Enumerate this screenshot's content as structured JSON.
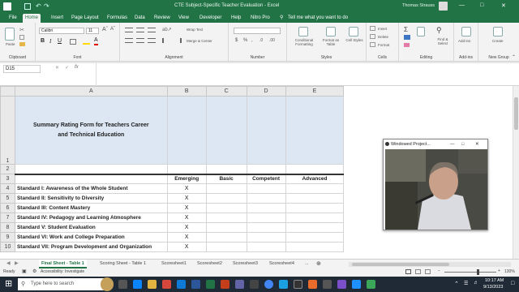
{
  "window": {
    "title": "CTE Subject-Specific Teacher Evaluation  -  Excel",
    "user": "Thomas Strauss",
    "minimize": "—",
    "maximize": "□",
    "close": "✕"
  },
  "ribbon_tabs": [
    "File",
    "Home",
    "Insert",
    "Page Layout",
    "Formulas",
    "Data",
    "Review",
    "View",
    "Developer",
    "Help",
    "Nitro Pro"
  ],
  "ribbon_active_tab": "Home",
  "tell_me": "Tell me what you want to do",
  "ribbon_groups": {
    "clipboard": "Clipboard",
    "font": "Font",
    "alignment": "Alignment",
    "number": "Number",
    "styles": "Styles",
    "cells": "Cells",
    "editing": "Editing",
    "addins": "Add-ins",
    "new_group": "New Group"
  },
  "ribbon_controls": {
    "paste": "Paste",
    "font_name": "Calibri",
    "font_size": "11",
    "bold": "B",
    "italic": "I",
    "underline": "U",
    "wrap_text": "Wrap Text",
    "merge_center": "Merge & Center",
    "number_format": "",
    "conditional": "Conditional Formatting",
    "format_table": "Format as Table",
    "cell_styles": "Cell Styles",
    "insert": "Insert",
    "delete": "Delete",
    "format": "Format",
    "sum": "Σ",
    "find_select": "Find & Select",
    "addins": "Add-ins",
    "create": "Create"
  },
  "formula_bar": {
    "name_box": "D15",
    "cancel": "✕",
    "enter": "✓",
    "fx": "fx",
    "formula": ""
  },
  "sheet": {
    "columns": [
      "A",
      "B",
      "C",
      "D",
      "E"
    ],
    "title": "Summary Rating Form for Teachers Career and Technical Education",
    "headers": [
      "Emerging",
      "Basic",
      "Competent",
      "Advanced"
    ],
    "rows": [
      {
        "num": "4",
        "label": "Standard I: Awareness of the Whole Student",
        "emerging": "X"
      },
      {
        "num": "5",
        "label": "Standard II: Sensitivity to Diversity",
        "emerging": "X"
      },
      {
        "num": "6",
        "label": "Standard III: Content Mastery",
        "emerging": "X"
      },
      {
        "num": "7",
        "label": "Standard IV: Pedagogy and Learning Atmosphere",
        "emerging": "X"
      },
      {
        "num": "8",
        "label": "Standard V:  Student Evaluation",
        "emerging": "X"
      },
      {
        "num": "9",
        "label": "Standard VI: Work and College Preparation",
        "emerging": "X"
      },
      {
        "num": "10",
        "label": "Standard VII: Program Development and Organization",
        "emerging": "X"
      }
    ],
    "row_numbers_top": [
      "1",
      "2",
      "3"
    ]
  },
  "sheet_tabs": [
    "Final Sheet - Table 1",
    "Scoring Sheet - Table 1",
    "Scoresheet1",
    "Scoresheet2",
    "Scoresheet3",
    "Scoresheet4"
  ],
  "sheet_tabs_more": "...",
  "sheet_tab_add": "⊕",
  "status": {
    "ready": "Ready",
    "accessibility": "Accessibility: Investigate",
    "zoom": "130%"
  },
  "taskbar": {
    "search_placeholder": "Type here to search",
    "time": "10:17 AM",
    "date": "9/13/2023"
  },
  "webcam": {
    "title": "Windowed Project...",
    "minimize": "—",
    "maximize": "□",
    "close": "✕"
  },
  "colors": {
    "excel_green": "#217346",
    "header_tint": "#dde7f3",
    "taskbar": "#1f2a36"
  }
}
